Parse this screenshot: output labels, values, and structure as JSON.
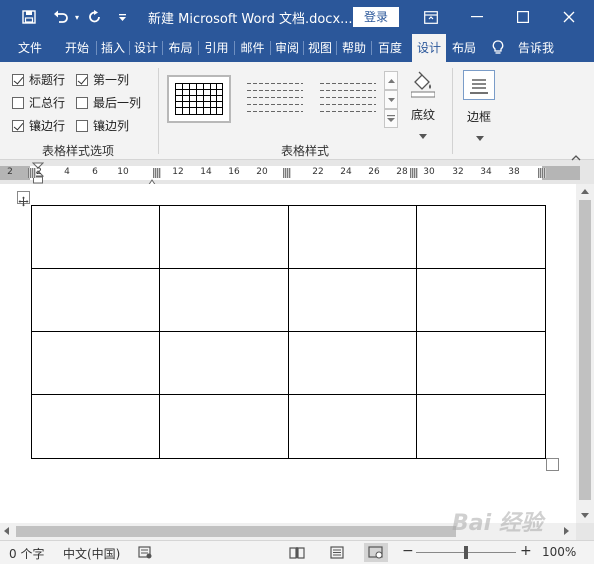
{
  "title_bar": {
    "document_title": "新建 Microsoft Word 文档.docx...",
    "login_label": "登录",
    "icons": [
      "save-icon",
      "undo-icon",
      "redo-icon",
      "customize-qat-icon",
      "ribbon-display-icon",
      "minimize-icon",
      "maximize-icon",
      "close-icon"
    ]
  },
  "tabs": [
    {
      "label": "文件"
    },
    {
      "label": "开始"
    },
    {
      "label": "插入"
    },
    {
      "label": "设计"
    },
    {
      "label": "布局"
    },
    {
      "label": "引用"
    },
    {
      "label": "邮件"
    },
    {
      "label": "审阅"
    },
    {
      "label": "视图"
    },
    {
      "label": "帮助"
    },
    {
      "label": "百度"
    },
    {
      "label": "设计",
      "active": true
    },
    {
      "label": "布局"
    },
    {
      "label": "告诉我"
    }
  ],
  "ribbon": {
    "style_options": {
      "group_label": "表格样式选项",
      "options": [
        {
          "label": "标题行",
          "checked": true
        },
        {
          "label": "第一列",
          "checked": true
        },
        {
          "label": "汇总行",
          "checked": false
        },
        {
          "label": "最后一列",
          "checked": false
        },
        {
          "label": "镶边行",
          "checked": true
        },
        {
          "label": "镶边列",
          "checked": false
        }
      ]
    },
    "table_styles": {
      "group_label": "表格样式"
    },
    "shading_label": "底纹",
    "borders_label": "边框"
  },
  "ruler": {
    "labels": [
      "2",
      "2",
      "4",
      "6",
      "10",
      "12",
      "14",
      "16",
      "20",
      "22",
      "24",
      "26",
      "28",
      "30",
      "32",
      "34",
      "38"
    ]
  },
  "document": {
    "table": {
      "rows": 4,
      "cols": 4
    }
  },
  "status_bar": {
    "word_count": "0 个字",
    "language": "中文(中国)",
    "zoom_minus": "−",
    "zoom_plus": "+",
    "zoom": "100%",
    "zoom_fraction": 0.5
  },
  "colors": {
    "title_bar": "#2b579a",
    "ribbon": "#f3f3f3",
    "accent": "#2b579a"
  },
  "watermark": "Bai 经验"
}
